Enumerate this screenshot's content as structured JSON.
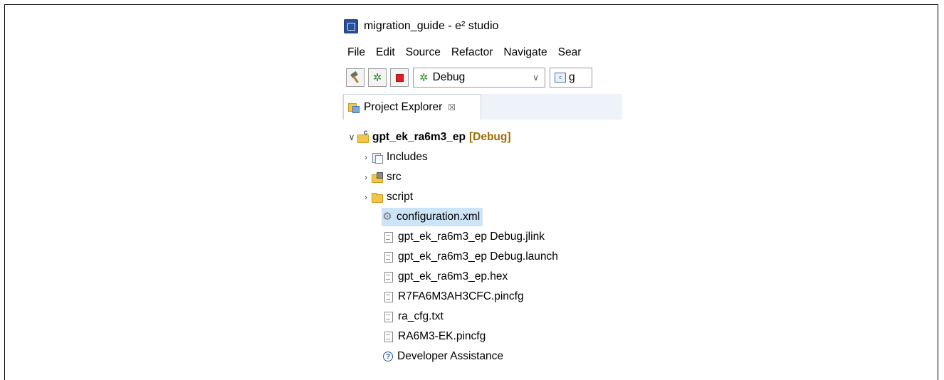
{
  "window": {
    "title": "migration_guide - e² studio"
  },
  "menubar": {
    "items": [
      "File",
      "Edit",
      "Source",
      "Refactor",
      "Navigate",
      "Sear"
    ]
  },
  "toolbar": {
    "build_icon": "hammer-icon",
    "debug_icon": "bug-icon",
    "stop_icon": "stop-icon",
    "launch_config_value": "Debug",
    "launch_target_value": "g"
  },
  "view": {
    "tab_label": "Project Explorer",
    "tab_close_glyph": "☒"
  },
  "tree": {
    "project": {
      "name": "gpt_ek_ra6m3_ep",
      "tag": "[Debug]",
      "expanded": true
    },
    "items": [
      {
        "label": "Includes",
        "icon": "includes-icon",
        "expandable": true
      },
      {
        "label": "src",
        "icon": "source-folder-icon",
        "expandable": true
      },
      {
        "label": "script",
        "icon": "folder-icon",
        "expandable": true
      },
      {
        "label": "configuration.xml",
        "icon": "gear-icon",
        "expandable": false,
        "selected": true
      },
      {
        "label": "gpt_ek_ra6m3_ep Debug.jlink",
        "icon": "file-icon",
        "expandable": false
      },
      {
        "label": "gpt_ek_ra6m3_ep Debug.launch",
        "icon": "file-icon",
        "expandable": false
      },
      {
        "label": "gpt_ek_ra6m3_ep.hex",
        "icon": "file-icon",
        "expandable": false
      },
      {
        "label": "R7FA6M3AH3CFC.pincfg",
        "icon": "file-icon",
        "expandable": false
      },
      {
        "label": "ra_cfg.txt",
        "icon": "file-icon",
        "expandable": false
      },
      {
        "label": "RA6M3-EK.pincfg",
        "icon": "file-icon",
        "expandable": false
      },
      {
        "label": "Developer Assistance",
        "icon": "help-icon",
        "expandable": false
      }
    ]
  },
  "colors": {
    "selection": "#cce4f7",
    "project_tag": "#a06a00",
    "tab_bar": "#eef3fa"
  }
}
